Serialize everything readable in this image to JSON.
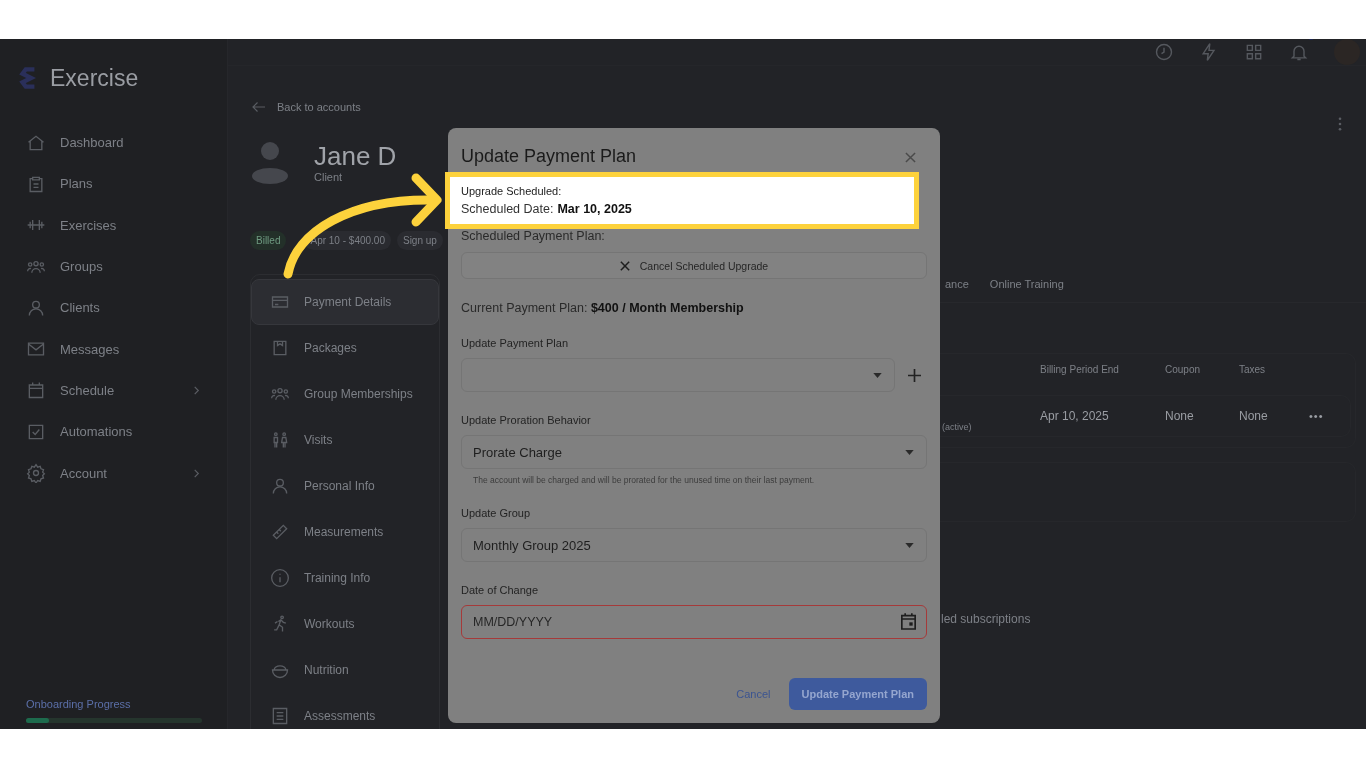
{
  "sidebar": {
    "logo": "Exercise",
    "items": [
      {
        "label": "Dashboard",
        "expandable": false
      },
      {
        "label": "Plans",
        "expandable": false
      },
      {
        "label": "Exercises",
        "expandable": false
      },
      {
        "label": "Groups",
        "expandable": false
      },
      {
        "label": "Clients",
        "expandable": false
      },
      {
        "label": "Messages",
        "expandable": false
      },
      {
        "label": "Schedule",
        "expandable": true
      },
      {
        "label": "Automations",
        "expandable": false
      },
      {
        "label": "Account",
        "expandable": true
      }
    ],
    "onboarding": {
      "label": "Onboarding Progress",
      "level": 0.13
    }
  },
  "account": {
    "back_link": "Back to accounts",
    "name": "Jane D",
    "role": "Client",
    "badges": [
      {
        "text": "Billed",
        "kind": "status"
      },
      {
        "text": "Apr 10 - $400.00",
        "kind": "plain"
      },
      {
        "text": "Sign up",
        "kind": "plain"
      }
    ],
    "menu": [
      {
        "label": "Payment Details",
        "selected": true
      },
      {
        "label": "Packages",
        "selected": false
      },
      {
        "label": "Group Memberships",
        "selected": false
      },
      {
        "label": "Visits",
        "selected": false
      },
      {
        "label": "Personal Info",
        "selected": false
      },
      {
        "label": "Measurements",
        "selected": false
      },
      {
        "label": "Training Info",
        "selected": false
      },
      {
        "label": "Workouts",
        "selected": false
      },
      {
        "label": "Nutrition",
        "selected": false
      },
      {
        "label": "Assessments",
        "selected": false
      }
    ]
  },
  "tabs": [
    {
      "label": "ance"
    },
    {
      "label": "Online Training"
    }
  ],
  "table": {
    "columns": [
      "Billing Period End",
      "Coupon",
      "Taxes"
    ],
    "rows": [
      {
        "status": "(active)",
        "cells": [
          "Apr 10, 2025",
          "None",
          "None"
        ],
        "menu": "•••"
      }
    ]
  },
  "footer_text": "led subscriptions",
  "modal": {
    "title": "Update Payment Plan",
    "scheduled": {
      "highlighted": true,
      "heading": "Upgrade Scheduled:",
      "date_label": "Scheduled Date:",
      "date": "Mar 10, 2025"
    },
    "scheduled_plan_label": "Scheduled Payment Plan:",
    "cancel_upgrade": "Cancel Scheduled Upgrade",
    "current_plan": "Current Payment Plan: **$400 / Month Membership**",
    "fields": [
      {
        "kind": "select",
        "label": "Update Payment Plan",
        "add": true
      },
      {
        "kind": "select",
        "label": "Update Proration Behavior",
        "add": false,
        "value": "Prorate Charge",
        "helper": "The account will be charged and will be prorated for the unused time on their last payment."
      },
      {
        "kind": "select",
        "label": "Update Group",
        "add": false,
        "value": "Monthly Group 2025"
      },
      {
        "kind": "date",
        "label": "Date of Change",
        "add": false,
        "placeholder": "MM/DD/YYYY",
        "invalid": true
      }
    ],
    "buttons": {
      "cancel": "Cancel",
      "submit": "Update Payment Plan"
    }
  }
}
